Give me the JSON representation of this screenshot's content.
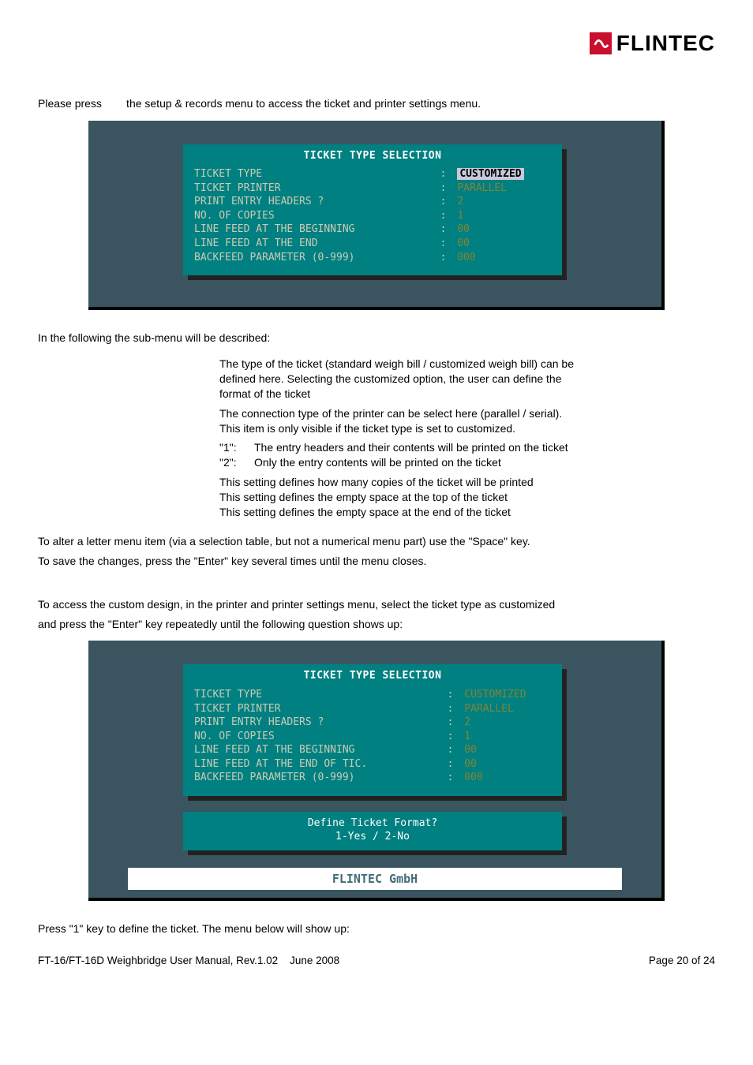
{
  "logo_text": "FLINTEC",
  "intro_line": "Please press        the setup & records menu to access the ticket and printer settings menu.",
  "terminal_title": "TICKET TYPE SELECTION",
  "screen1_rows": [
    {
      "label": "TICKET TYPE",
      "val": "CUSTOMIZED",
      "hl": true
    },
    {
      "label": "TICKET PRINTER",
      "val": "PARALLEL"
    },
    {
      "label": "PRINT ENTRY HEADERS ?",
      "val": "2"
    },
    {
      "label": "NO. OF COPIES",
      "val": "1"
    },
    {
      "label": "LINE FEED AT THE BEGINNING",
      "val": "00"
    },
    {
      "label": "LINE FEED AT THE END",
      "val": "00"
    },
    {
      "label": "BACKFEED PARAMETER (0-999)",
      "val": "000"
    }
  ],
  "submenu_heading": "In the following the sub-menu will be described:",
  "desc_block1": [
    "The type of the ticket (standard weigh bill / customized weigh bill) can be",
    "defined here. Selecting the customized option, the user can define the",
    "format of the ticket"
  ],
  "desc_block2": [
    "The connection type of the printer can be select here (parallel / serial).",
    "This item is only visible if the ticket type is set to customized."
  ],
  "opt1_key": "\"1\":",
  "opt1_text": "The entry headers and their contents will be printed on the ticket",
  "opt2_key": "\"2\":",
  "opt2_text": "Only the entry contents will be printed on the ticket",
  "desc_block3": [
    "This setting defines how many copies of the ticket will be printed",
    "This setting defines the empty space at the top of the ticket",
    "This setting defines the empty space at the end of the ticket"
  ],
  "alter_line1": "To alter a letter menu item (via a selection table, but not a numerical menu part) use the \"Space\" key.",
  "alter_line2": "To save the changes, press the \"Enter\" key several times until the menu closes.",
  "custom_line1": "To access the custom design, in the printer and printer settings menu, select the ticket type as customized",
  "custom_line2": "and press the \"Enter\" key repeatedly until the following question shows up:",
  "screen2_rows": [
    {
      "label": "TICKET TYPE",
      "val": "CUSTOMIZED"
    },
    {
      "label": "TICKET PRINTER",
      "val": "PARALLEL"
    },
    {
      "label": "PRINT ENTRY HEADERS ?",
      "val": "2"
    },
    {
      "label": "NO. OF COPIES",
      "val": "1"
    },
    {
      "label": "LINE FEED AT THE BEGINNING",
      "val": "00"
    },
    {
      "label": "LINE FEED AT THE END OF TIC.",
      "val": "00"
    },
    {
      "label": "BACKFEED PARAMETER (0-999)",
      "val": "000"
    }
  ],
  "prompt_line1": "Define Ticket Format?",
  "prompt_line2": "1-Yes / 2-No",
  "brand_bar": "FLINTEC GmbH",
  "press1_line": "Press \"1\" key to define the ticket. The menu below will show up:",
  "footer_left": "FT-16/FT-16D Weighbridge User Manual, Rev.1.02    June 2008",
  "footer_right": "Page 20 of 24"
}
